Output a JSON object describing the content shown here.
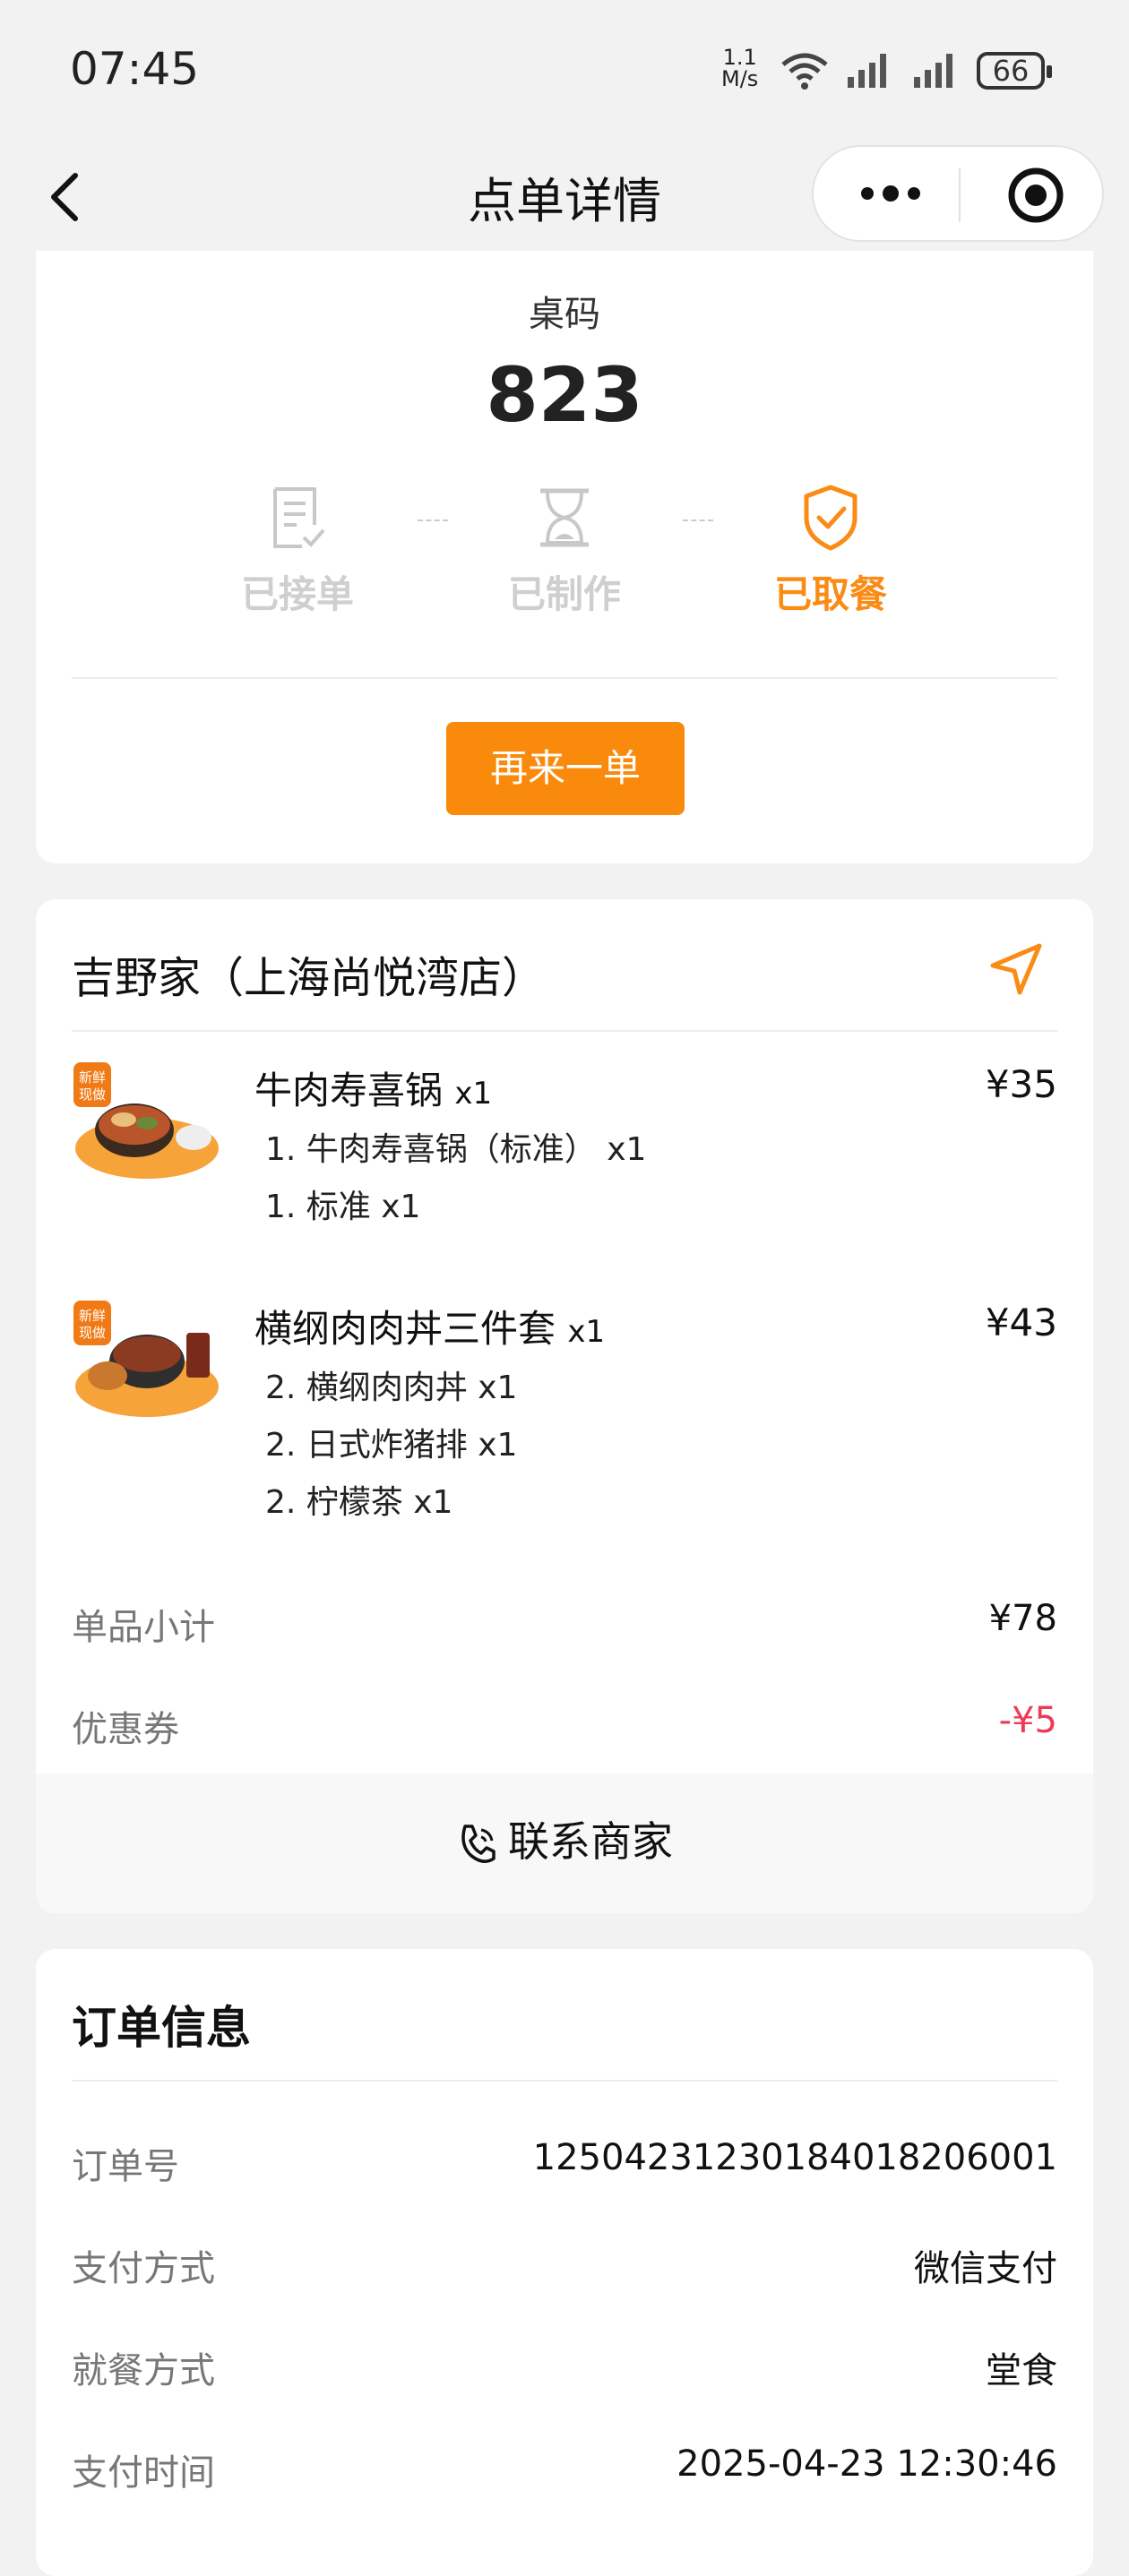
{
  "status_bar": {
    "time": "07:45",
    "net_speed_value": "1.1",
    "net_speed_unit": "M/s",
    "battery": "66"
  },
  "nav": {
    "title": "点单详情"
  },
  "pickup": {
    "table_label": "桌码",
    "table_number": "823",
    "steps": [
      {
        "label": "已接单",
        "icon": "receipt-icon",
        "active": false
      },
      {
        "label": "已制作",
        "icon": "hourglass-icon",
        "active": false
      },
      {
        "label": "已取餐",
        "icon": "shield-check-icon",
        "active": true
      }
    ],
    "reorder_label": "再来一单",
    "accent_color": "#fa8a0b"
  },
  "order": {
    "store_name": "吉野家（上海尚悦湾店）",
    "items": [
      {
        "badge": "新鲜现做",
        "name": "牛肉寿喜锅",
        "qty": "x1",
        "price": "¥35",
        "lines": [
          "1. 牛肉寿喜锅（标准） x1",
          "1. 标准 x1"
        ]
      },
      {
        "badge": "新鲜现做",
        "name": "横纲肉肉丼三件套",
        "qty": "x1",
        "price": "¥43",
        "lines": [
          "2. 横纲肉肉丼 x1",
          "2. 日式炸猪排 x1",
          "2. 柠檬茶 x1"
        ]
      }
    ],
    "subtotal_label": "单品小计",
    "subtotal_value": "¥78",
    "coupon_label": "优惠券",
    "coupon_value": "-¥5",
    "contact_label": "联系商家"
  },
  "info": {
    "title": "订单信息",
    "rows": [
      {
        "label": "订单号",
        "value": "1250423123018401820600​1"
      },
      {
        "label": "支付方式",
        "value": "微信支付"
      },
      {
        "label": "就餐方式",
        "value": "堂食"
      },
      {
        "label": "支付时间",
        "value": "2025-04-23 12:30:46"
      }
    ]
  }
}
